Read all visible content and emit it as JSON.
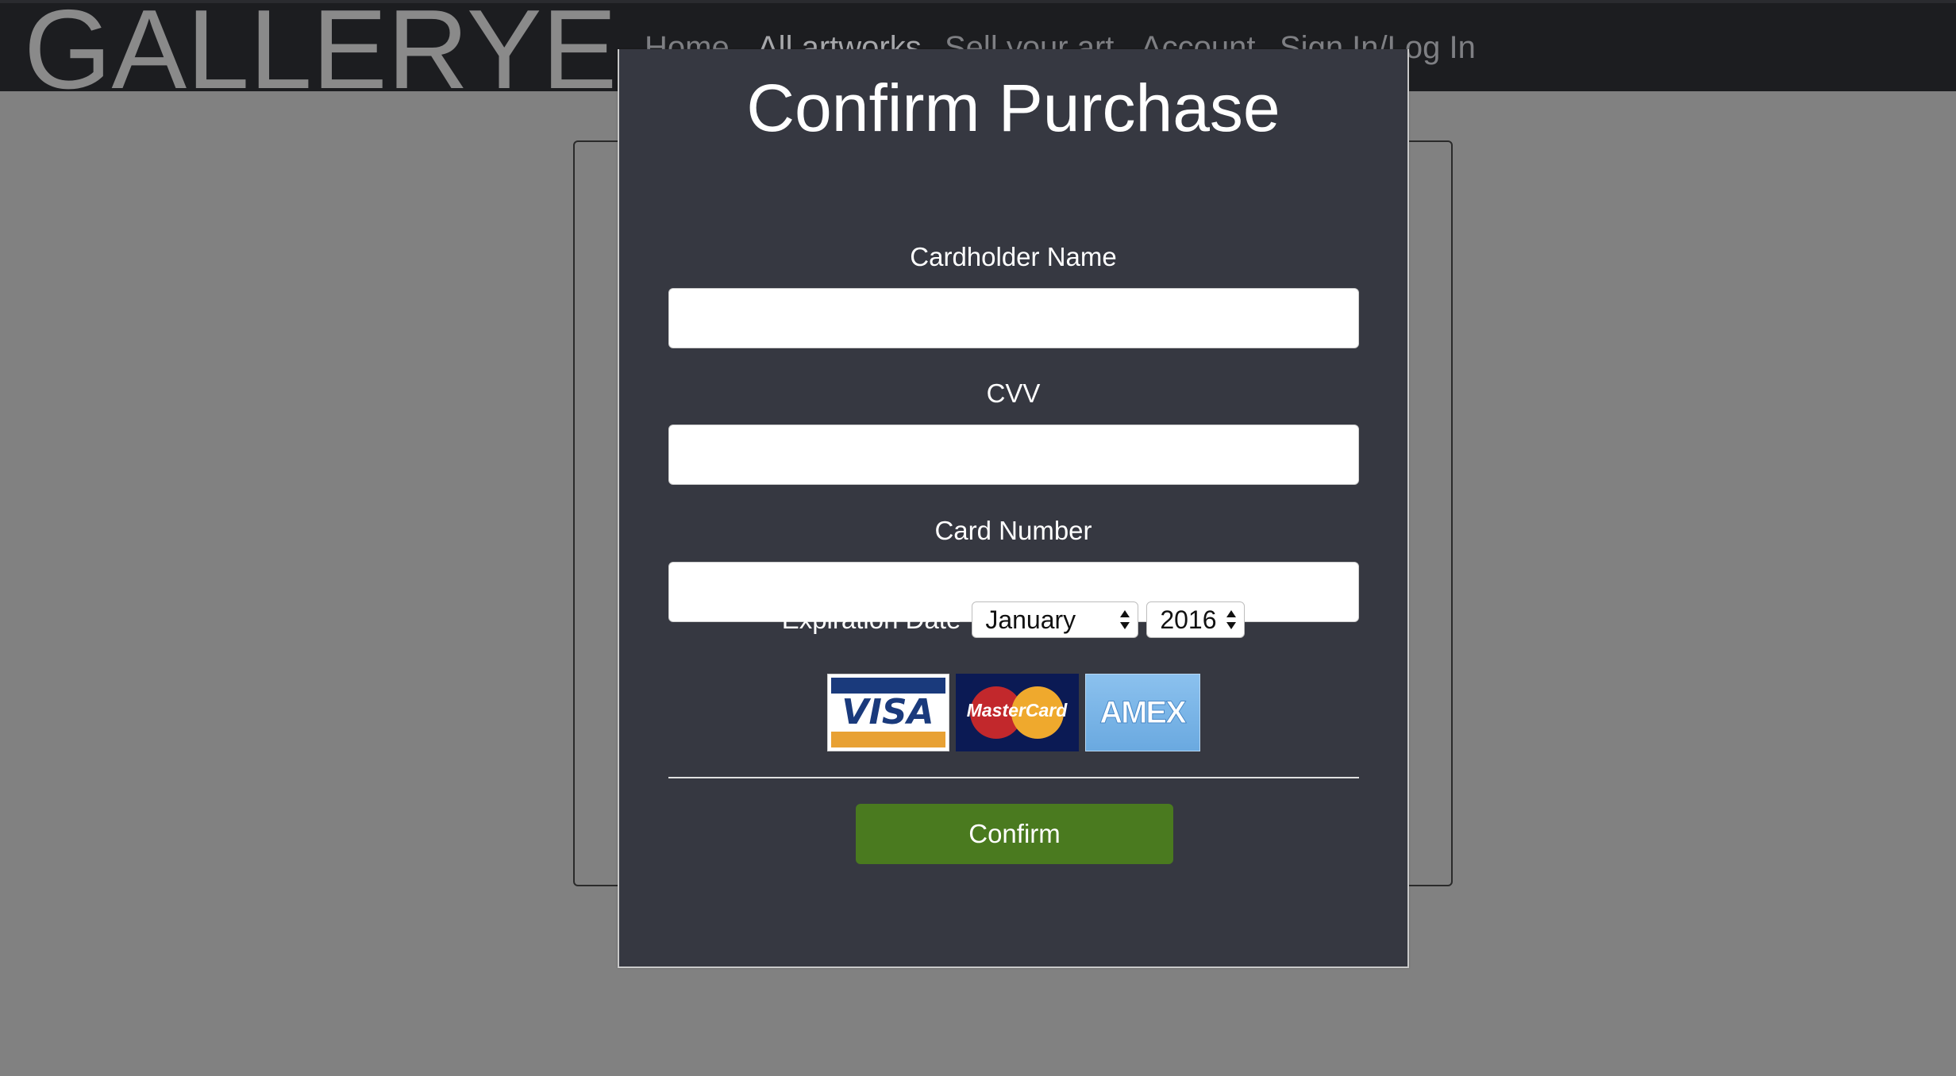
{
  "nav": {
    "logo": "GALLERYE",
    "links": [
      "Home",
      "All artworks",
      "Sell your art",
      "Account",
      "Sign In/Log In"
    ]
  },
  "modal": {
    "title": "Confirm Purchase",
    "cardholder_label": "Cardholder Name",
    "cardholder_value": "",
    "cvv_label": "CVV",
    "cvv_value": "",
    "card_number_label": "Card Number",
    "card_number_value": "",
    "expiration_label": "Expiration Date",
    "month_selected": "January",
    "year_selected": "2016",
    "card_logos": [
      "VISA",
      "MasterCard",
      "AMEX"
    ],
    "confirm_label": "Confirm"
  },
  "colors": {
    "nav_bg": "#1c1d20",
    "page_bg": "#818181",
    "modal_bg": "#363841",
    "confirm_bg": "#4a7a1f"
  }
}
